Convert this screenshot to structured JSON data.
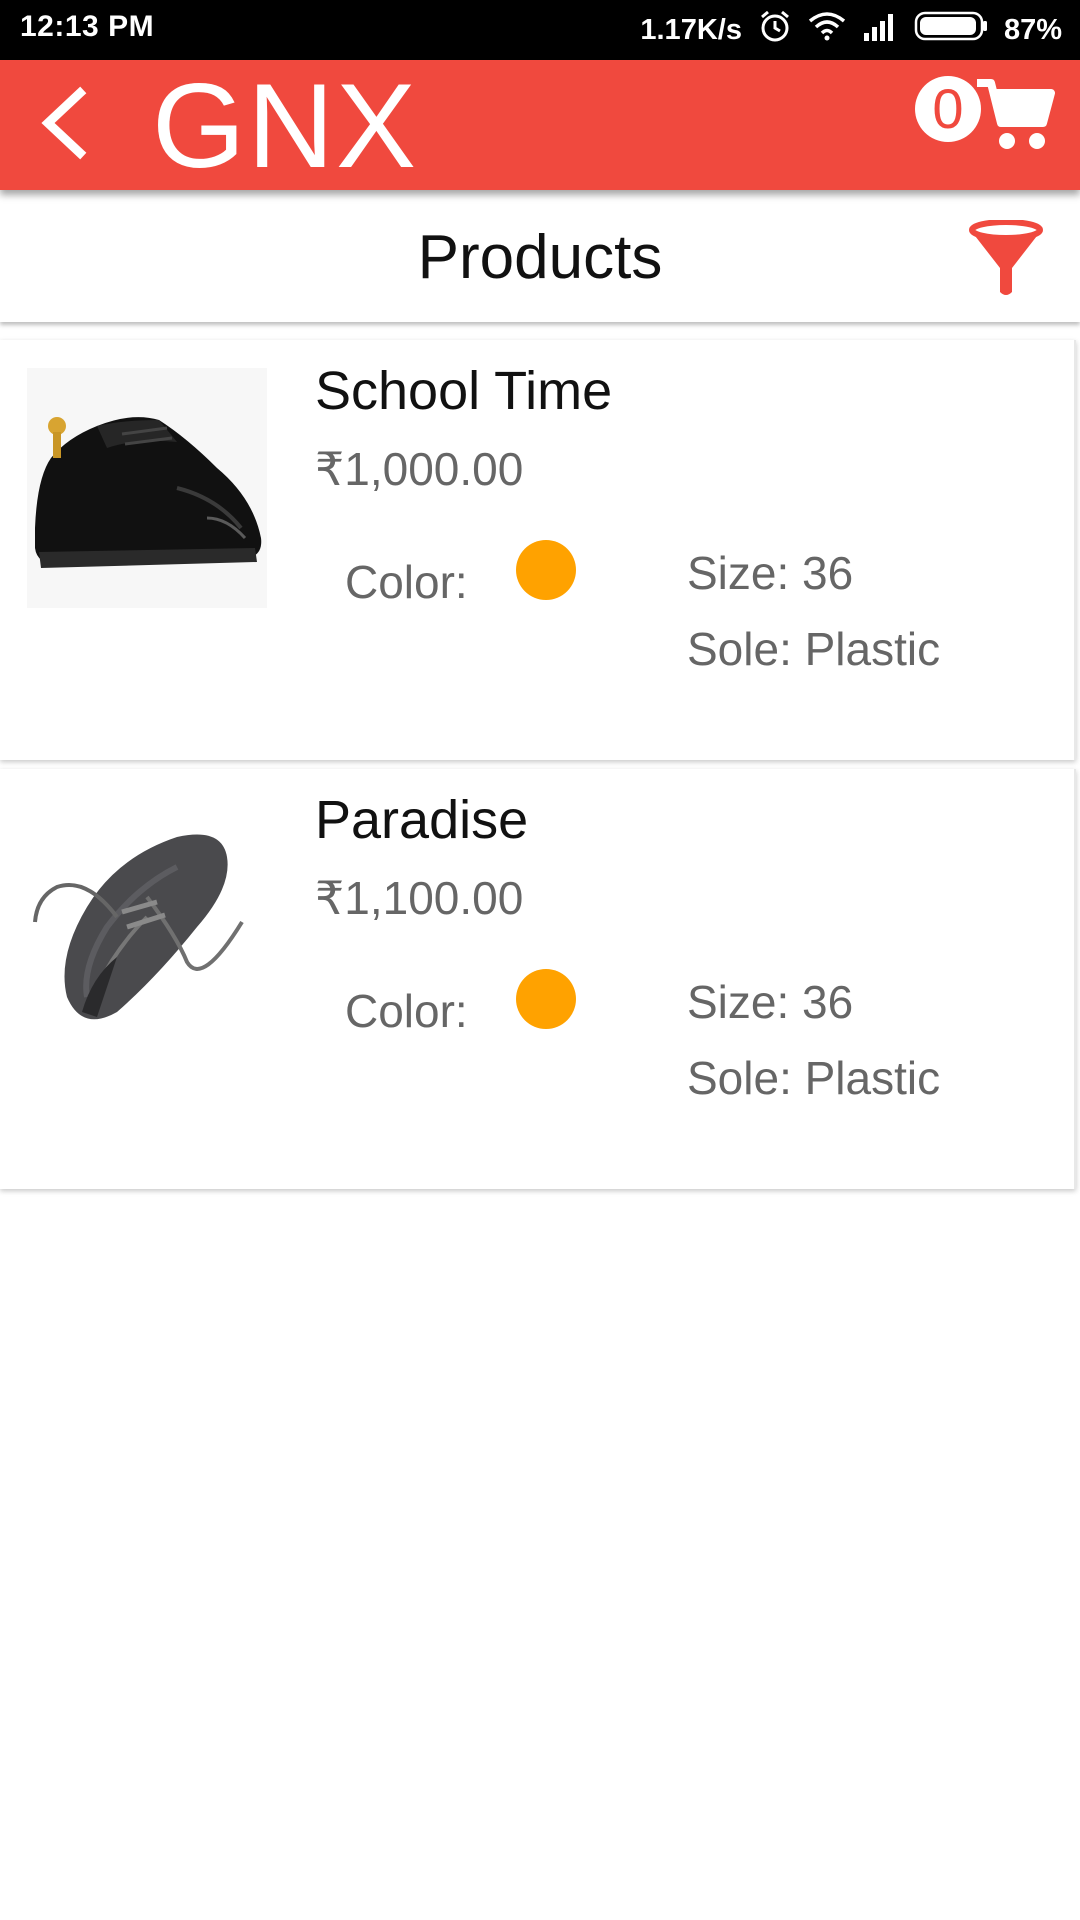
{
  "status_bar": {
    "time": "12:13 PM",
    "network_speed": "1.17K/s",
    "battery": "87%",
    "icons": [
      "alarm-icon",
      "wifi-icon",
      "signal-icon",
      "battery-icon"
    ]
  },
  "app_bar": {
    "title": "GNX",
    "cart_count": "0",
    "color": "#f0493e",
    "icons": [
      "back-arrow-icon",
      "cart-icon"
    ]
  },
  "header": {
    "title": "Products",
    "filter_icon": "funnel-icon"
  },
  "products": [
    {
      "name": "School Time",
      "price": "₹1,000.00",
      "color_label": "Color:",
      "color": "#ffa200",
      "size": "Size: 36",
      "sole": "Sole: Plastic",
      "image": "black-leather-shoe"
    },
    {
      "name": "Paradise",
      "price": "₹1,100.00",
      "color_label": "Color:",
      "color": "#ffa200",
      "size": "Size: 36",
      "sole": "Sole: Plastic",
      "image": "grey-wool-shoe"
    }
  ]
}
